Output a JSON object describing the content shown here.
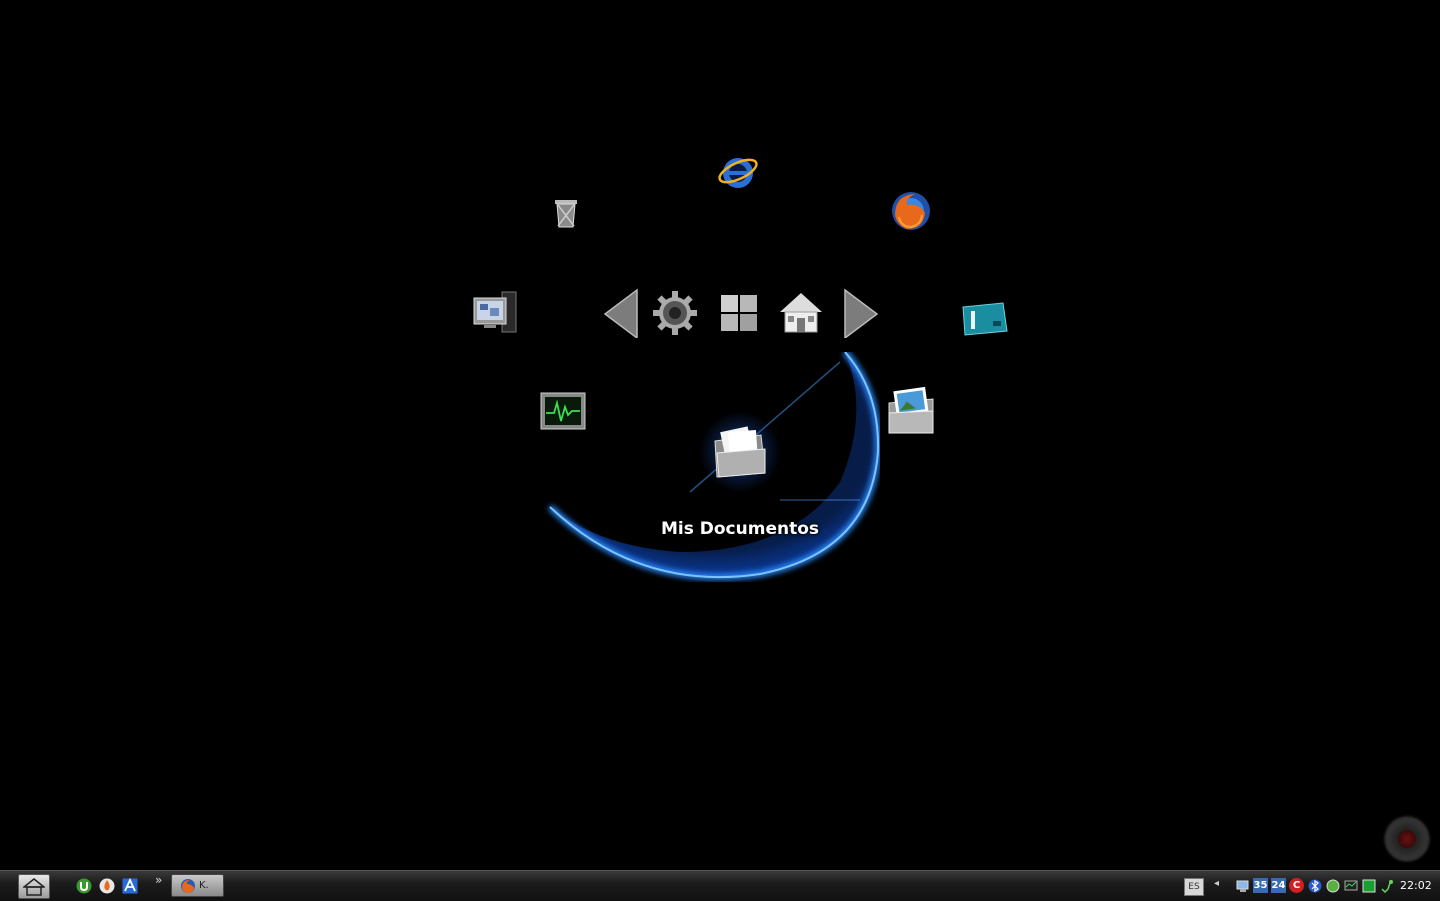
{
  "dock": {
    "selected_label": "Mis Documentos",
    "items": [
      {
        "name": "internet-explorer",
        "icon": "internet-explorer-icon"
      },
      {
        "name": "recycle-bin",
        "icon": "trash-icon"
      },
      {
        "name": "firefox",
        "icon": "firefox-icon"
      },
      {
        "name": "my-computer",
        "icon": "computer-icon"
      },
      {
        "name": "drive",
        "icon": "drive-icon"
      },
      {
        "name": "system-monitor",
        "icon": "monitor-pulse-icon"
      },
      {
        "name": "pictures",
        "icon": "picture-folder-icon"
      },
      {
        "name": "my-documents",
        "icon": "documents-folder-icon"
      }
    ],
    "nav": [
      "arrow-left-icon",
      "gear-icon",
      "windows-logo-icon",
      "house-icon",
      "arrow-right-icon"
    ]
  },
  "taskbar": {
    "task_label": "K.",
    "quick_launch": [
      "utorrent-icon",
      "fire-icon",
      "a-app-icon"
    ],
    "chevron": "»",
    "language": "ES",
    "tray_arrow": "◂",
    "tray_icons": [
      {
        "icon": "network-icon",
        "text": ""
      },
      {
        "icon": "temp-badge-icon",
        "text": "35"
      },
      {
        "icon": "temp-badge-icon",
        "text": "24"
      },
      {
        "icon": "antivirus-icon",
        "text": "C"
      },
      {
        "icon": "bluetooth-icon",
        "text": ""
      },
      {
        "icon": "green-circle-icon",
        "text": ""
      },
      {
        "icon": "monitor-icon",
        "text": ""
      },
      {
        "icon": "green-square-icon",
        "text": ""
      },
      {
        "icon": "phone-icon",
        "text": ""
      }
    ],
    "clock": "22:02"
  },
  "colors": {
    "background": "#000000",
    "planet_glow": "#1e7bff",
    "taskbar": "#1c1c1c"
  }
}
